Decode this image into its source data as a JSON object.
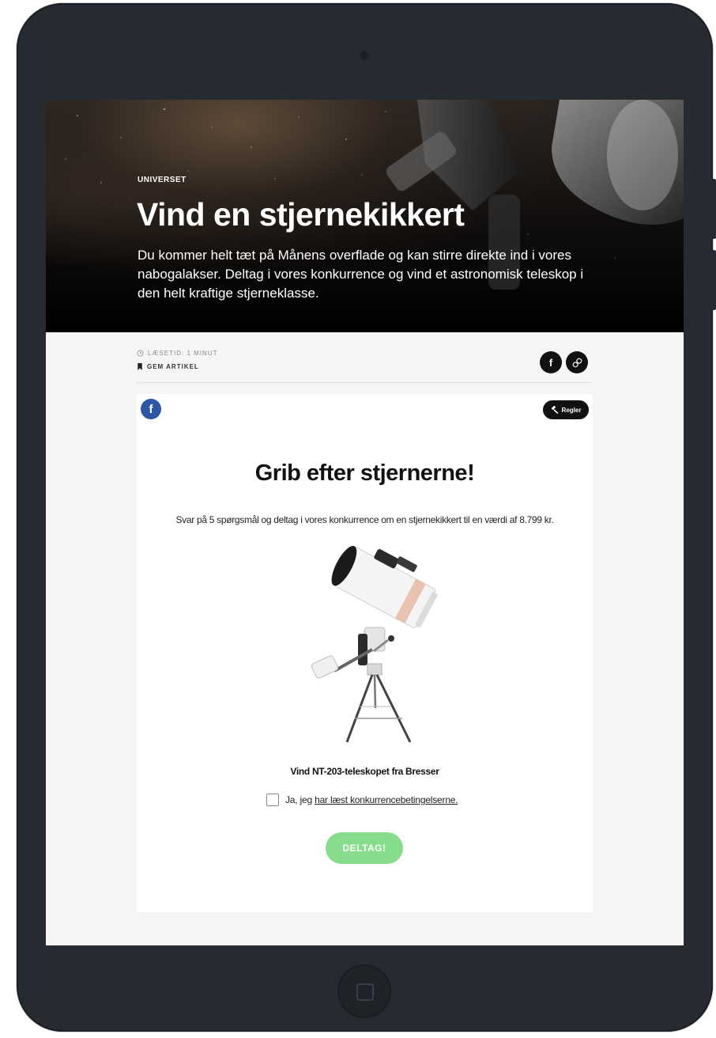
{
  "hero": {
    "category": "UNIVERSET",
    "title": "Vind en stjernekikkert",
    "description": "Du kommer helt tæt på Månens overflade og kan stirre direkte ind i vores nabogalakser. Deltag i vores konkurrence og vind et astronomisk teleskop i den helt kraftige stjerneklasse."
  },
  "meta": {
    "read_time": "LÆSETID: 1 MINUT",
    "save_label": "GEM ARTIKEL",
    "share_facebook_icon": "f",
    "share_link_icon": "🔗"
  },
  "contest": {
    "facebook_icon": "f",
    "rules_label": "Regler",
    "title": "Grib efter stjernerne!",
    "subtitle": "Svar på 5 spørgsmål og deltag i vores konkurrence om en stjernekikkert til en værdi af 8.799 kr.",
    "product_caption": "Vind NT-203-teleskopet fra Bresser",
    "consent_prefix": "Ja, jeg ",
    "consent_link": "har læst konkurrencebetingelserne.",
    "submit_label": "DELTAG!",
    "submit_color": "#86dd8c"
  },
  "icons": {
    "clock": "clock-icon",
    "bookmark": "bookmark-icon",
    "hammer": "gavel-icon"
  }
}
